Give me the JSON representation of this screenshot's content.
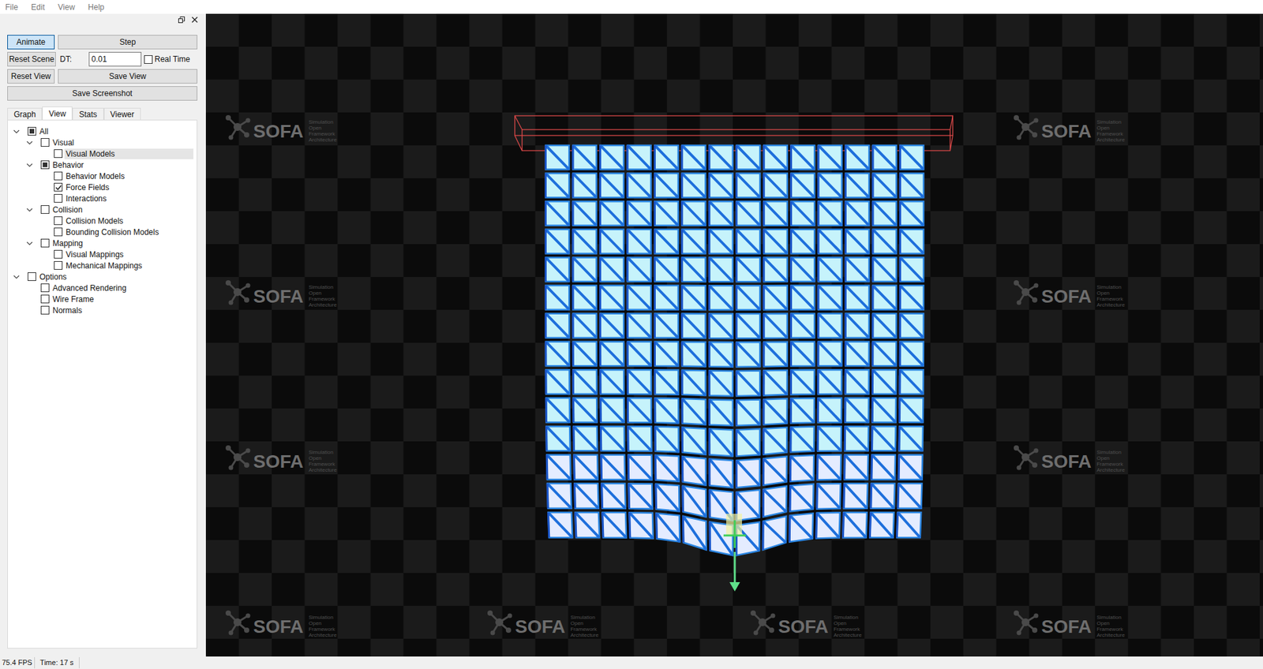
{
  "menu": [
    "File",
    "Edit",
    "View",
    "Help"
  ],
  "controls": {
    "animate": {
      "label": "Animate",
      "selected": true
    },
    "step": "Step",
    "reset_scene": "Reset Scene",
    "dt_label": "DT:",
    "dt_value": "0.01",
    "real_time": {
      "label": "Real Time",
      "checked": false
    },
    "reset_view": "Reset View",
    "save_view": "Save View",
    "save_screenshot": "Save Screenshot"
  },
  "tabs": [
    {
      "label": "Graph",
      "selected": false
    },
    {
      "label": "View",
      "selected": true
    },
    {
      "label": "Stats",
      "selected": false
    },
    {
      "label": "Viewer",
      "selected": false
    }
  ],
  "tree": [
    {
      "label": "All",
      "checked": false,
      "partial": true,
      "expanded": true,
      "selected": false,
      "children": [
        {
          "label": "Visual",
          "checked": false,
          "partial": false,
          "expanded": true,
          "selected": false,
          "children": [
            {
              "label": "Visual Models",
              "checked": false,
              "partial": false,
              "expanded": false,
              "selected": true,
              "children": []
            }
          ]
        },
        {
          "label": "Behavior",
          "checked": false,
          "partial": true,
          "expanded": true,
          "selected": false,
          "children": [
            {
              "label": "Behavior Models",
              "checked": false,
              "partial": false,
              "expanded": false,
              "selected": false,
              "children": []
            },
            {
              "label": "Force Fields",
              "checked": true,
              "partial": false,
              "expanded": false,
              "selected": false,
              "children": []
            },
            {
              "label": "Interactions",
              "checked": false,
              "partial": false,
              "expanded": false,
              "selected": false,
              "children": []
            }
          ]
        },
        {
          "label": "Collision",
          "checked": false,
          "partial": false,
          "expanded": true,
          "selected": false,
          "children": [
            {
              "label": "Collision Models",
              "checked": false,
              "partial": false,
              "expanded": false,
              "selected": false,
              "children": []
            },
            {
              "label": "Bounding Collision Models",
              "checked": false,
              "partial": false,
              "expanded": false,
              "selected": false,
              "children": []
            }
          ]
        },
        {
          "label": "Mapping",
          "checked": false,
          "partial": false,
          "expanded": true,
          "selected": false,
          "children": [
            {
              "label": "Visual Mappings",
              "checked": false,
              "partial": false,
              "expanded": false,
              "selected": false,
              "children": []
            },
            {
              "label": "Mechanical Mappings",
              "checked": false,
              "partial": false,
              "expanded": false,
              "selected": false,
              "children": []
            }
          ]
        }
      ]
    },
    {
      "label": "Options",
      "checked": false,
      "partial": false,
      "expanded": true,
      "selected": false,
      "children": [
        {
          "label": "Advanced Rendering",
          "checked": false,
          "partial": false,
          "expanded": false,
          "selected": false,
          "children": []
        },
        {
          "label": "Wire Frame",
          "checked": false,
          "partial": false,
          "expanded": false,
          "selected": false,
          "children": []
        },
        {
          "label": "Normals",
          "checked": false,
          "partial": false,
          "expanded": false,
          "selected": false,
          "children": []
        }
      ]
    }
  ],
  "watermark": {
    "logo": "SOFA",
    "tagline": [
      "Simulation",
      "Open",
      "Framework",
      "Architecture"
    ]
  },
  "watermark_tiles": [
    {
      "shown": true
    },
    {
      "shown": false
    },
    {
      "shown": false
    },
    {
      "shown": true
    },
    {
      "shown": true
    },
    {
      "shown": false
    },
    {
      "shown": false
    },
    {
      "shown": true
    },
    {
      "shown": true
    },
    {
      "shown": false
    },
    {
      "shown": false
    },
    {
      "shown": true
    },
    {
      "shown": true
    },
    {
      "shown": true
    },
    {
      "shown": true
    },
    {
      "shown": true
    }
  ],
  "status_bar": {
    "fps": "75.4 FPS",
    "time": "Time: 17 s"
  }
}
